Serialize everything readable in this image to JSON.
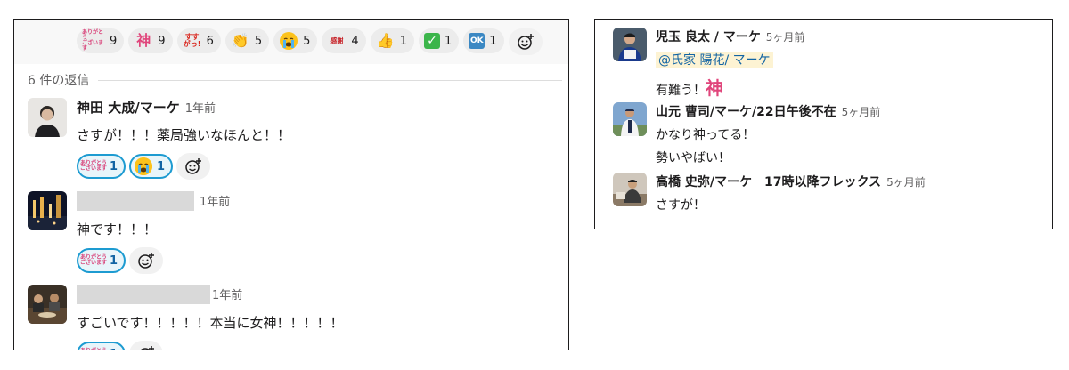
{
  "thread": {
    "top_reactions": [
      {
        "emoji": "arigato",
        "count": "9"
      },
      {
        "emoji": "kami",
        "count": "9"
      },
      {
        "emoji": "sugoi",
        "count": "6"
      },
      {
        "emoji": "clap",
        "count": "5"
      },
      {
        "emoji": "cry",
        "count": "5"
      },
      {
        "emoji": "kansha",
        "count": "4"
      },
      {
        "emoji": "thumbs-up",
        "count": "1"
      },
      {
        "emoji": "check",
        "count": "1"
      },
      {
        "emoji": "ok",
        "count": "1"
      }
    ],
    "replies_label": "6 件の返信",
    "messages": [
      {
        "name": "神田 大成/マーケ",
        "time": "1年前",
        "text": "さすが！！！薬局強いなほんと！！",
        "reactions": [
          {
            "emoji": "arigato",
            "count": "1"
          },
          {
            "emoji": "cry",
            "count": "1"
          }
        ]
      },
      {
        "name": "",
        "time": "1年前",
        "text": "神です！！！",
        "reactions": [
          {
            "emoji": "arigato",
            "count": "1"
          }
        ]
      },
      {
        "name": "",
        "time": "1年前",
        "text": "すごいです！！！！！本当に女神！！！！！",
        "reactions": [
          {
            "emoji": "arigato",
            "count": "1"
          }
        ]
      }
    ],
    "emoji_text": {
      "kami": "神",
      "arigato_line1": "ありがとう",
      "arigato_line2": "ございます",
      "sugoi_line1": "すす",
      "sugoi_line2": "がっ!",
      "kansha": "感謝",
      "ok": "OK",
      "check": "✓",
      "thumb": "👍",
      "clap": "👏"
    }
  },
  "right_thread": {
    "messages": [
      {
        "name": "児玉 良太 / マーケ",
        "time": "5ヶ月前",
        "mention": "@氏家 陽花/ マーケ",
        "line1": "有難う！",
        "kami": "神"
      },
      {
        "name": "山元 曹司/マーケ/22日午後不在",
        "time": "5ヶ月前",
        "line1": "かなり神ってる！",
        "line2": "勢いやばい！"
      },
      {
        "name": "高橋 史弥/マーケ　17時以降フレックス",
        "time": "5ヶ月前",
        "line1": "さすが！"
      }
    ]
  },
  "colors": {
    "accent": "#1d9bd1",
    "mention_bg": "#fdf3d3",
    "kami_pink": "#e0457b"
  }
}
